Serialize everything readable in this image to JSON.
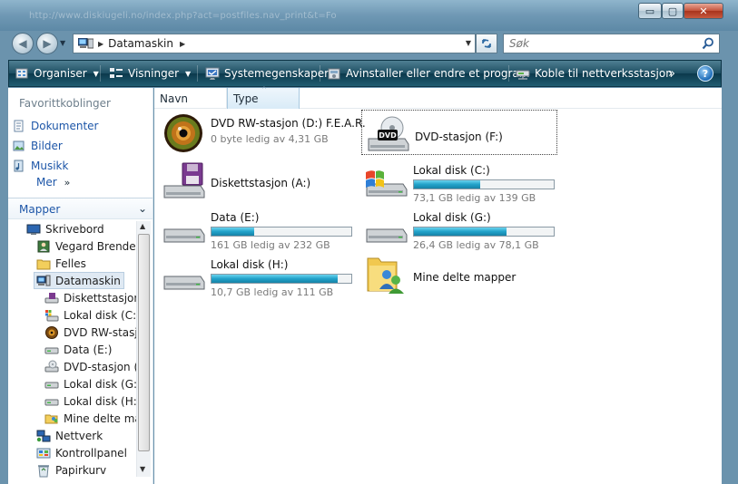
{
  "window": {
    "ghost_url": "http://www.diskiugeli.no/index.php?act=postfiles.nav_print&t=Fo",
    "min": "▭",
    "max": "▢",
    "close": "✕"
  },
  "nav": {
    "back": "◀",
    "forward": "▶",
    "path": "Datamaskin",
    "search_placeholder": "Søk"
  },
  "toolbar": {
    "items": [
      {
        "label": "Organiser",
        "icon": "organize-icon",
        "caret": "▼"
      },
      {
        "label": "Visninger",
        "icon": "views-icon",
        "caret": "▼"
      },
      {
        "label": "Systemegenskaper",
        "icon": "system-properties-icon"
      },
      {
        "label": "Avinstaller eller endre et program",
        "icon": "uninstall-icon"
      },
      {
        "label": "Koble til nettverksstasjon",
        "icon": "map-network-drive-icon"
      }
    ],
    "more": "»",
    "help": "?"
  },
  "sidebar": {
    "favorites_header": "Favorittkoblinger",
    "favorites": [
      {
        "label": "Dokumenter",
        "icon": "documents-icon"
      },
      {
        "label": "Bilder",
        "icon": "pictures-icon"
      },
      {
        "label": "Musikk",
        "icon": "music-icon"
      }
    ],
    "more_label": "Mer",
    "more_icon": "»",
    "folders_header": "Mapper",
    "folders_chevron": "⌄",
    "tree": [
      {
        "label": "Skrivebord",
        "icon": "desktop-icon"
      },
      {
        "label": "Vegard Brenden",
        "icon": "user-folder-icon"
      },
      {
        "label": "Felles",
        "icon": "folder-icon"
      },
      {
        "label": "Datamaskin",
        "icon": "computer-icon",
        "selected": true
      },
      {
        "label": "Diskettstasjon",
        "icon": "floppy-drive-icon"
      },
      {
        "label": "Lokal disk (C:)",
        "icon": "windows-drive-icon"
      },
      {
        "label": "DVD RW-stasjo",
        "icon": "dvd-rw-drive-icon"
      },
      {
        "label": "Data (E:)",
        "icon": "hard-drive-icon"
      },
      {
        "label": "DVD-stasjon (F",
        "icon": "dvd-drive-icon"
      },
      {
        "label": "Lokal disk (G:)",
        "icon": "hard-drive-icon"
      },
      {
        "label": "Lokal disk (H:)",
        "icon": "hard-drive-icon"
      },
      {
        "label": "Mine delte ma",
        "icon": "shared-folders-icon"
      },
      {
        "label": "Nettverk",
        "icon": "network-icon"
      },
      {
        "label": "Kontrollpanel",
        "icon": "control-panel-icon"
      },
      {
        "label": "Papirkurv",
        "icon": "recycle-bin-icon"
      }
    ]
  },
  "columns": {
    "name": "Navn",
    "type": "Type",
    "sort_indicator": "^"
  },
  "drives": [
    {
      "name": "DVD RW-stasjon (D:) F.E.A.R.",
      "free": "0 byte ledig av 4,31 GB",
      "icon": "fear-disc-icon"
    },
    {
      "name": "DVD-stasjon (F:)",
      "icon": "dvd-drive-icon",
      "focused": true
    },
    {
      "name": "Diskettstasjon (A:)",
      "icon": "floppy-drive-icon"
    },
    {
      "name": "Lokal disk (C:)",
      "free": "73,1 GB ledig av 139 GB",
      "used_fraction": 0.474,
      "icon": "windows-drive-icon"
    },
    {
      "name": "Data (E:)",
      "free": "161 GB ledig av 232 GB",
      "used_fraction": 0.306,
      "icon": "hard-drive-icon"
    },
    {
      "name": "Lokal disk (G:)",
      "free": "26,4 GB ledig av 78,1 GB",
      "used_fraction": 0.662,
      "icon": "hard-drive-icon"
    },
    {
      "name": "Lokal disk (H:)",
      "free": "10,7 GB ledig av 111 GB",
      "used_fraction": 0.904,
      "icon": "hard-drive-icon"
    },
    {
      "name": "Mine delte mapper",
      "icon": "shared-folders-icon"
    }
  ],
  "colors": {
    "frame": "#6b93ad",
    "toolbar": "#1d4e62",
    "link": "#1d56a8",
    "bar_fill": "#21a2c9"
  }
}
